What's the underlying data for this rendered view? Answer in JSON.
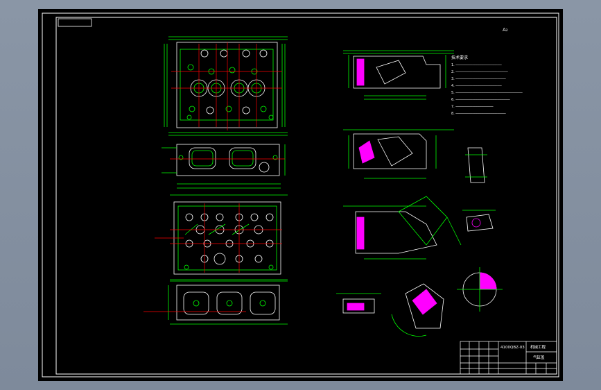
{
  "drawing": {
    "sheet_background": "#000000",
    "border_color": "#ffffff",
    "outline_color": "#ffffff",
    "part_color": "#00ff00",
    "centerline_color": "#ff0000",
    "hatch_color": "#ff00ff",
    "dimension_color": "#00ff00",
    "top_mark": "A₂",
    "title_block": {
      "part_code": "4100QBZ-03",
      "title_right": "气缸盖",
      "school": "机械工程",
      "row_labels": [
        "",
        "",
        "",
        ""
      ]
    },
    "notes": {
      "header": "技术要求",
      "lines": [
        "1. ──────────────────────",
        "2. ─────────────────────────",
        "3. ────────────────────────",
        "4. ──────────────────────",
        "5. ────────────────────────────────",
        "6. ──────────────────────────",
        "7. ──────────────────",
        "8. ────────────────────────"
      ]
    }
  }
}
